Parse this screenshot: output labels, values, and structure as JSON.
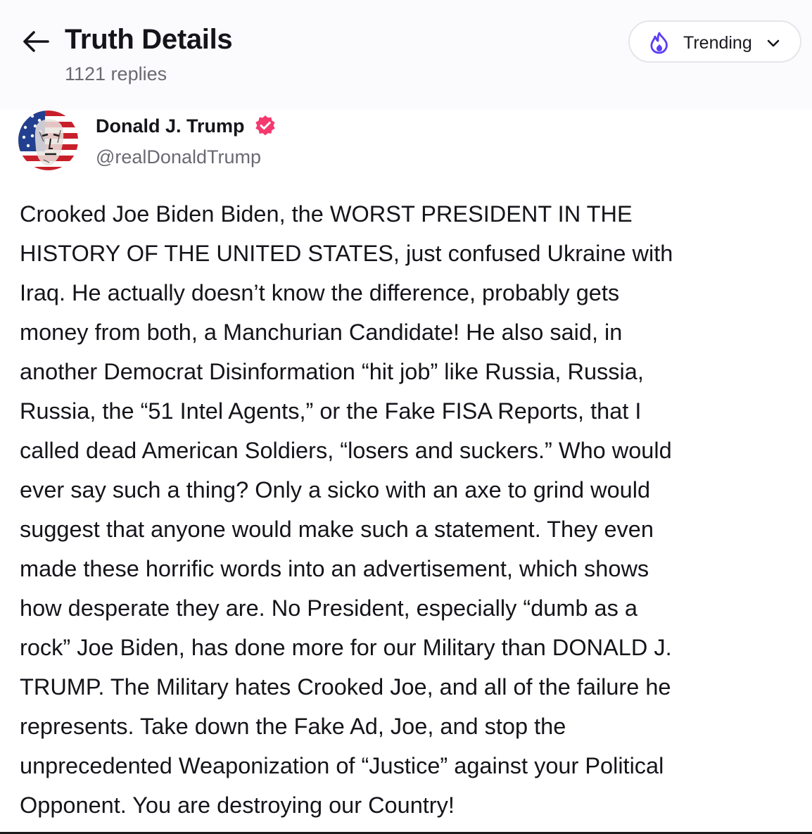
{
  "header": {
    "title": "Truth Details",
    "replies": "1121 replies",
    "back_icon": "arrow-left-icon",
    "sort": {
      "label": "Trending",
      "icon": "flame-icon",
      "chevron": "chevron-down-icon"
    }
  },
  "post": {
    "author": {
      "name": "Donald J. Trump",
      "handle": "@realDonaldTrump",
      "verified": true,
      "verified_icon": "verified-badge-icon"
    },
    "lines": [
      "Crooked Joe Biden Biden, the WORST PRESIDENT IN THE",
      "HISTORY OF THE UNITED STATES, just confused Ukraine with",
      "Iraq. He actually doesn’t know the difference, probably gets",
      "money from both, a Manchurian Candidate! He also said, in",
      "another Democrat Disinformation “hit job” like Russia, Russia,",
      "Russia, the “51 Intel Agents,” or the Fake FISA Reports, that I",
      "called dead American Soldiers, “losers and suckers.” Who would",
      "ever say such a thing? Only a sicko with an axe to grind would",
      "suggest that anyone would make such a statement. They even",
      "made these horrific words into an advertisement, which shows",
      "how desperate they are. No President, especially “dumb as a",
      "rock” Joe Biden, has done more for our Military than DONALD J.",
      "TRUMP. The Military hates Crooked Joe, and all of the failure he",
      "represents. Take down the Fake Ad, Joe, and stop the",
      "unprecedented Weaponization of “Justice” against your Political",
      "Opponent. You are destroying our Country!"
    ]
  },
  "colors": {
    "header_bg": "#fbfafc",
    "text_primary": "#15141a",
    "text_secondary": "#6b6a72",
    "accent_purple": "#5b3df5",
    "verified_pink": "#f5386e"
  }
}
